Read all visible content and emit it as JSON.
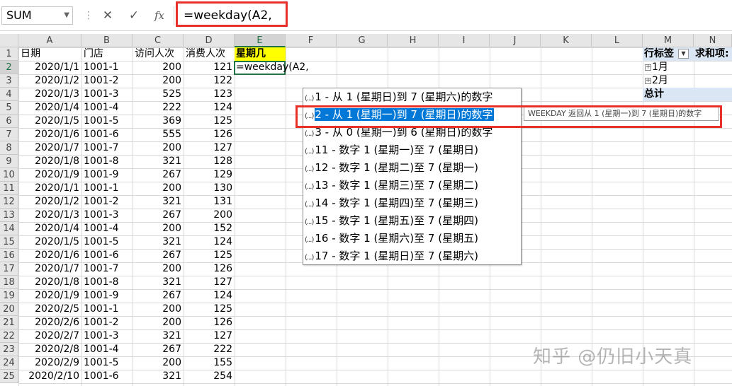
{
  "formula_bar": {
    "name_box": "SUM",
    "cancel_icon": "✕",
    "enter_icon": "✓",
    "fx_label": "fx",
    "formula": "=weekday(A2,"
  },
  "columns": [
    "A",
    "B",
    "C",
    "D",
    "E",
    "F",
    "G",
    "H",
    "I",
    "J",
    "K",
    "L",
    "M",
    "N"
  ],
  "rows": [
    "1",
    "2",
    "3",
    "4",
    "5",
    "6",
    "7",
    "8",
    "9",
    "10",
    "11",
    "12",
    "13",
    "14",
    "15",
    "16",
    "17",
    "18",
    "19",
    "20",
    "21",
    "22",
    "23",
    "24",
    "25"
  ],
  "headers": {
    "a": "日期",
    "b": "门店",
    "c": "访问人次",
    "d": "消费人次",
    "e": "星期几"
  },
  "active_cell_text": "=weekday(A2,",
  "table": [
    [
      "2020/1/1",
      "1001-1",
      "200",
      "121"
    ],
    [
      "2020/1/2",
      "1001-2",
      "200",
      "122"
    ],
    [
      "2020/1/3",
      "1001-3",
      "525",
      "123"
    ],
    [
      "2020/1/4",
      "1001-4",
      "222",
      "124"
    ],
    [
      "2020/1/5",
      "1001-5",
      "369",
      "125"
    ],
    [
      "2020/1/6",
      "1001-6",
      "555",
      "126"
    ],
    [
      "2020/1/7",
      "1001-7",
      "200",
      "127"
    ],
    [
      "2020/1/8",
      "1001-8",
      "321",
      "128"
    ],
    [
      "2020/1/9",
      "1001-9",
      "267",
      "129"
    ],
    [
      "2020/1/1",
      "1001-1",
      "200",
      "130"
    ],
    [
      "2020/1/2",
      "1001-2",
      "321",
      "131"
    ],
    [
      "2020/1/3",
      "1001-3",
      "267",
      "200"
    ],
    [
      "2020/1/4",
      "1001-4",
      "200",
      "152"
    ],
    [
      "2020/1/5",
      "1001-5",
      "321",
      "124"
    ],
    [
      "2020/1/6",
      "1001-6",
      "267",
      "125"
    ],
    [
      "2020/1/7",
      "1001-7",
      "200",
      "126"
    ],
    [
      "2020/1/8",
      "1001-8",
      "321",
      "127"
    ],
    [
      "2020/1/9",
      "1001-9",
      "267",
      "124"
    ],
    [
      "2020/2/5",
      "1001-1",
      "200",
      "125"
    ],
    [
      "2020/2/6",
      "1001-2",
      "200",
      "126"
    ],
    [
      "2020/2/7",
      "1001-3",
      "321",
      "127"
    ],
    [
      "2020/2/8",
      "1001-4",
      "267",
      "222"
    ],
    [
      "2020/2/9",
      "1001-5",
      "200",
      "155"
    ],
    [
      "2020/2/10",
      "1001-6",
      "321",
      "254"
    ]
  ],
  "pivot": {
    "row_label": "行标签",
    "sum_label": "求和项:",
    "items": [
      "1月",
      "2月"
    ],
    "total": "总计"
  },
  "autocomplete": {
    "items": [
      "1 - 从 1 (星期日)到 7 (星期六)的数字",
      "2 - 从 1 (星期一)到 7 (星期日)的数字",
      "3 - 从 0 (星期一)到 6 (星期日)的数字",
      "11 - 数字 1 (星期一)至 7 (星期日)",
      "12 - 数字 1 (星期二)至 7 (星期一)",
      "13 - 数字 1 (星期三)至 7 (星期二)",
      "14 - 数字 1 (星期四)至 7 (星期三)",
      "15 - 数字 1 (星期五)至 7 (星期四)",
      "16 - 数字 1 (星期六)至 7 (星期五)",
      "17 - 数字 1 (星期日)至 7 (星期六)"
    ],
    "highlighted_index": 1,
    "item_icon": "(...)",
    "tooltip": "WEEKDAY 返回从 1 (星期一)到 7 (星期日)的数字"
  },
  "watermark": "知乎 @仍旧小天真",
  "colors": {
    "accent_red": "#e8302a",
    "selection_blue": "#0078d7",
    "excel_green": "#217346",
    "header_yellow": "#ffff00"
  }
}
